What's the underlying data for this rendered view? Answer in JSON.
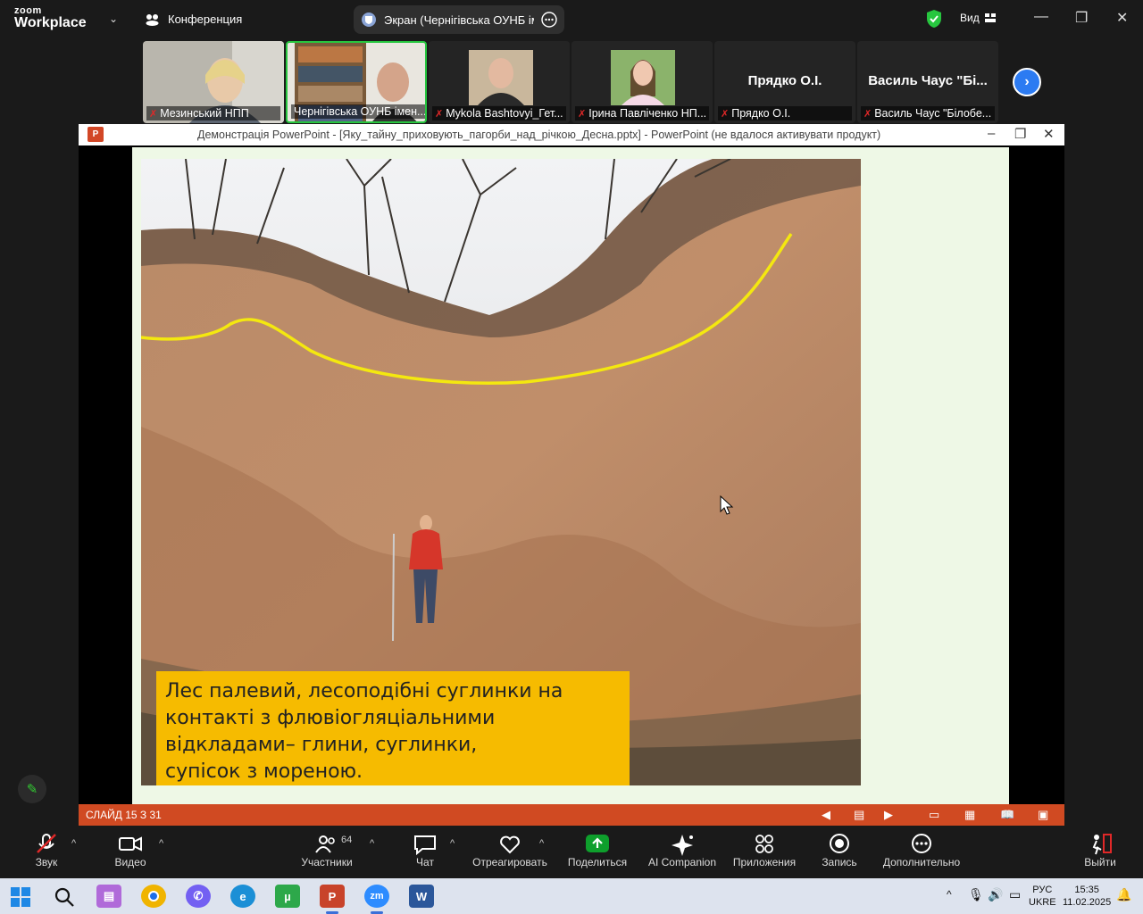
{
  "app": {
    "brand_top": "zoom",
    "brand_bottom": "Workplace",
    "conference_label": "Конференция",
    "screen_share_label": "Экран (Чернігівська ОУНБ імен",
    "view_label": "Вид"
  },
  "participants": [
    {
      "name": "Мезинський НПП",
      "muted": true
    },
    {
      "name": "Чернігівська ОУНБ імен...",
      "muted": false,
      "active": true
    },
    {
      "name": "Mykola Bashtovyi_Гет...",
      "muted": true
    },
    {
      "name": "Ірина Павліченко НП...",
      "muted": true
    },
    {
      "name": "Прядко О.І.",
      "display_name": "Прядко О.І.",
      "muted": true
    },
    {
      "name": "Василь Чаус \"Білобе...",
      "display_name": "Василь Чаус \"Бі...",
      "muted": true
    }
  ],
  "powerpoint": {
    "title": "Демонстрація PowerPoint - [Яку_тайну_приховують_пагорби_над_річкою_Десна.pptx] - PowerPoint (не вдалося активувати продукт)",
    "icon_letter": "P",
    "caption_lines": [
      "Лес палевий, лесоподібні суглинки на",
      "контакті з флювіогляціальними",
      "відкладами– глини, суглинки,",
      "супісок з мореною."
    ],
    "status": "СЛАЙД 15 З 31"
  },
  "toolbar": {
    "sound": "Звук",
    "video": "Видео",
    "participants": "Участники",
    "participants_count": "64",
    "chat": "Чат",
    "react": "Отреагировать",
    "share": "Поделиться",
    "ai": "AI Companion",
    "apps": "Приложения",
    "record": "Запись",
    "more": "Дополнительно",
    "leave": "Выйти"
  },
  "taskbar": {
    "lang_top": "РУС",
    "lang_bottom": "UKRE",
    "time": "15:35",
    "date": "11.02.2025",
    "zoom_label": "zm",
    "word_label": "W",
    "ppt_label": "P"
  },
  "colors": {
    "accent_green": "#27c63f",
    "share_green": "#0e9f2c",
    "ppt_orange": "#d04a22",
    "caption_yellow": "#f6bb00",
    "next_blue": "#2c7bf2"
  }
}
